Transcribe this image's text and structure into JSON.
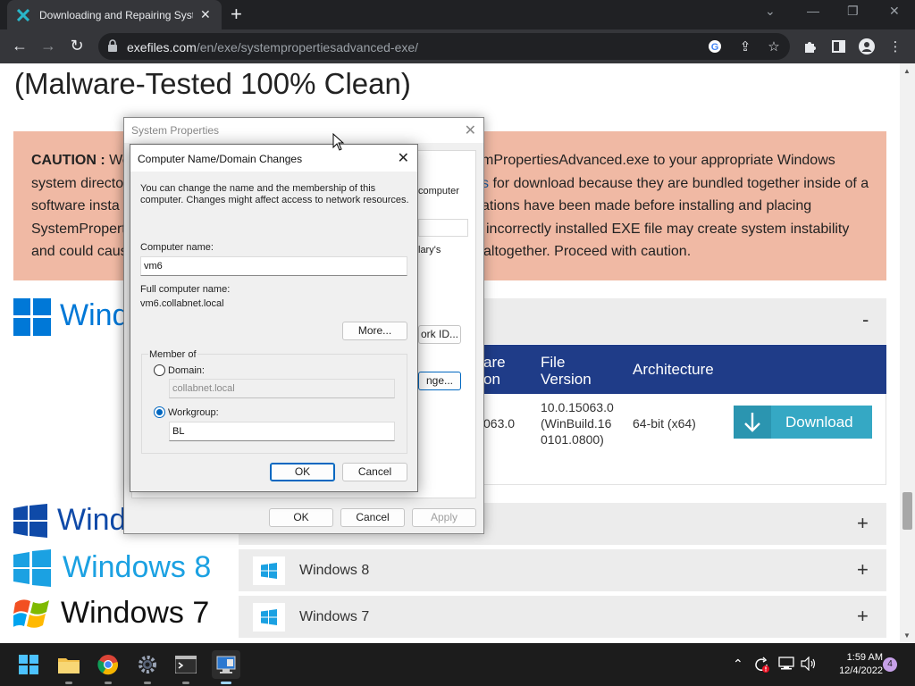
{
  "browser": {
    "tab_title": "Downloading and Repairing System",
    "url_host": "exefiles.com",
    "url_path": "/en/exe/systempropertiesadvanced-exe/"
  },
  "page": {
    "heading": "(Malware-Tested 100% Clean)",
    "caution": {
      "label": "CAUTION :",
      "line1_left": "We",
      "line1_right": "mPropertiesAdvanced.exe to your appropriate Windows",
      "line2_left": "system directo",
      "line2_link": "s",
      "line2_right": " for download because they are bundled together inside of a",
      "line3_left": "software insta",
      "line3_right": "ations have been made before installing and placing",
      "line4_left": "SystemPropert",
      "line4_right": "incorrectly installed EXE file may create system instability",
      "line5_left": "and could caus",
      "line5_right": "altogether. Proceed with caution."
    },
    "sections": [
      {
        "brand": "Wind",
        "collapse": "-"
      },
      {
        "brand": "Wind",
        "row_name": "",
        "toggle": "+"
      },
      {
        "brand": "Windows",
        "version": "8",
        "row_name": "Windows 8",
        "toggle": "+"
      },
      {
        "brand": "Windows",
        "version": "7",
        "row_name": "Windows 7",
        "toggle": "+"
      }
    ],
    "table": {
      "headers": [
        "are\non",
        "File\nVersion",
        "Architecture"
      ],
      "row": {
        "product_version": "063.0",
        "file_version": "10.0.15063.0\n(WinBuild.16\n0101.0800)",
        "architecture": "64-bit (x64)",
        "download": "Download"
      }
    }
  },
  "system_properties": {
    "title": "System Properties",
    "partial_computer": "computer",
    "partial_wizard": "lary's",
    "network_id": "ork ID...",
    "change": "nge...",
    "ok": "OK",
    "cancel": "Cancel",
    "apply": "Apply"
  },
  "computer_name_dialog": {
    "title": "Computer Name/Domain Changes",
    "description": "You can change the name and the membership of this\ncomputer. Changes might affect access to network resources.",
    "computer_name_label": "Computer name:",
    "computer_name_value": "vm6",
    "full_name_label": "Full computer name:",
    "full_name_value": "vm6.collabnet.local",
    "more_button": "More...",
    "member_of_label": "Member of",
    "domain_label": "Domain:",
    "domain_value": "collabnet.local",
    "workgroup_label": "Workgroup:",
    "workgroup_value": "BL",
    "selected_membership": "workgroup",
    "ok": "OK",
    "cancel": "Cancel"
  },
  "taskbar": {
    "apps": [
      "start",
      "file-explorer",
      "chrome",
      "settings",
      "terminal",
      "system-properties"
    ],
    "active_app": "system-properties",
    "time": "1:59 AM",
    "date": "12/4/2022",
    "notification_count": "4"
  }
}
